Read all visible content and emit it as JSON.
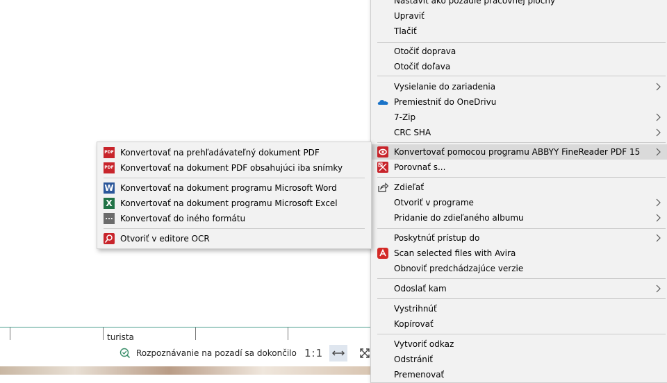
{
  "status_bar": {
    "ocr_status": "Rozpoznávanie na pozadí sa dokončilo",
    "zoom_one_to_one": "1:1",
    "table_cell_text": "turista"
  },
  "main_menu": {
    "items": [
      {
        "label": "Nastaviť ako pozadie pracovnej plochy",
        "icon": "",
        "submenu": false
      },
      {
        "label": "Upraviť",
        "icon": "",
        "submenu": false
      },
      {
        "label": "Tlačiť",
        "icon": "",
        "submenu": false
      },
      {
        "label": "Otočiť doprava",
        "icon": "",
        "submenu": false
      },
      {
        "label": "Otočiť doľava",
        "icon": "",
        "submenu": false
      },
      {
        "label": "Vysielanie do zariadenia",
        "icon": "",
        "submenu": true
      },
      {
        "label": "Premiestniť do OneDrivu",
        "icon": "onedrive-icon",
        "submenu": false
      },
      {
        "label": "7-Zip",
        "icon": "",
        "submenu": true
      },
      {
        "label": "CRC SHA",
        "icon": "",
        "submenu": true
      },
      {
        "label": "Konvertovať pomocou programu ABBYY FineReader PDF 15",
        "icon": "abbyy-finereader-icon",
        "submenu": true,
        "highlighted": true
      },
      {
        "label": "Porovnať s...",
        "icon": "abbyy-compare-icon",
        "submenu": false
      },
      {
        "label": "Zdieľať",
        "icon": "share-icon",
        "submenu": false
      },
      {
        "label": "Otvoriť v programe",
        "icon": "",
        "submenu": true
      },
      {
        "label": "Pridanie do zdieľaného albumu",
        "icon": "",
        "submenu": true
      },
      {
        "label": "Poskytnúť prístup do",
        "icon": "",
        "submenu": true
      },
      {
        "label": "Scan selected files with Avira",
        "icon": "avira-icon",
        "submenu": false
      },
      {
        "label": "Obnoviť predchádzajúce verzie",
        "icon": "",
        "submenu": false
      },
      {
        "label": "Odoslať kam",
        "icon": "",
        "submenu": true
      },
      {
        "label": "Vystrihnúť",
        "icon": "",
        "submenu": false
      },
      {
        "label": "Kopírovať",
        "icon": "",
        "submenu": false
      },
      {
        "label": "Vytvoriť odkaz",
        "icon": "",
        "submenu": false
      },
      {
        "label": "Odstrániť",
        "icon": "",
        "submenu": false
      },
      {
        "label": "Premenovať",
        "icon": "",
        "submenu": false
      }
    ]
  },
  "sub_menu": {
    "items": [
      {
        "label": "Konvertovať na prehľadávateľný dokument PDF",
        "icon": "pdf-icon",
        "icon_text": "PDF"
      },
      {
        "label": "Konvertovať na dokument PDF obsahujúci iba snímky",
        "icon": "pdf-icon",
        "icon_text": "PDF"
      },
      {
        "label": "Konvertovať na dokument programu Microsoft Word",
        "icon": "word-icon",
        "icon_text": "W"
      },
      {
        "label": "Konvertovať na dokument programu Microsoft Excel",
        "icon": "excel-icon",
        "icon_text": "X"
      },
      {
        "label": "Konvertovať do iného formátu",
        "icon": "other-format-icon",
        "icon_text": "..."
      },
      {
        "label": "Otvoriť v editore OCR",
        "icon": "ocr-editor-icon",
        "icon_text": ""
      }
    ]
  },
  "colors": {
    "menu_bg": "#f2f2f2",
    "highlight": "#dadada",
    "separator": "#c9c9c9",
    "abbyy_red": "#c8242b",
    "onedrive_blue": "#1a73c8"
  }
}
